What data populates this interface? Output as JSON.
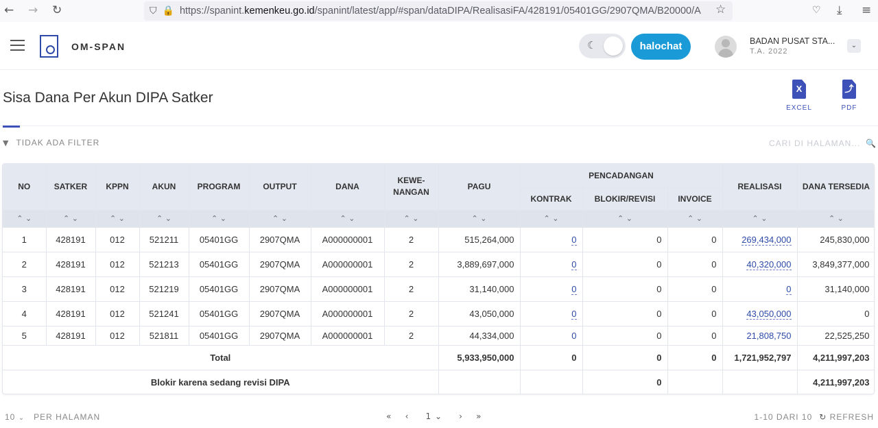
{
  "browser": {
    "url_prefix": "https://spanint.",
    "url_domain": "kemenkeu.go.id",
    "url_rest": "/spanint/latest/app/#span/dataDIPA/RealisasiFA/428191/05401GG/2907QMA/B20000/A"
  },
  "app": {
    "brand": "OM-SPAN",
    "chat_label": "halochat",
    "user_name": "BADAN PUSAT STA...",
    "user_year": "T.A. 2022"
  },
  "page": {
    "title": "Sisa Dana Per Akun DIPA Satker",
    "export_excel": "EXCEL",
    "export_pdf": "PDF",
    "filter": "TIDAK ADA FILTER",
    "search_placeholder": "CARI DI HALAMAN..."
  },
  "table": {
    "headers": {
      "no": "NO",
      "satker": "SATKER",
      "kppn": "KPPN",
      "akun": "AKUN",
      "program": "PROGRAM",
      "output": "OUTPUT",
      "dana": "DANA",
      "kewenangan": "KEWE-NANGAN",
      "pagu": "PAGU",
      "pencadangan": "PENCADANGAN",
      "kontrak": "KONTRAK",
      "blokir": "BLOKIR/REVISI",
      "invoice": "INVOICE",
      "realisasi": "REALISASI",
      "dana_tersedia": "DANA TERSEDIA"
    },
    "rows": [
      {
        "no": "1",
        "satker": "428191",
        "kppn": "012",
        "akun": "521211",
        "program": "05401GG",
        "output": "2907QMA",
        "dana": "A000000001",
        "kew": "2",
        "pagu": "515,264,000",
        "kontrak": "0",
        "blokir": "0",
        "invoice": "0",
        "realisasi": "269,434,000",
        "tersedia": "245,830,000"
      },
      {
        "no": "2",
        "satker": "428191",
        "kppn": "012",
        "akun": "521213",
        "program": "05401GG",
        "output": "2907QMA",
        "dana": "A000000001",
        "kew": "2",
        "pagu": "3,889,697,000",
        "kontrak": "0",
        "blokir": "0",
        "invoice": "0",
        "realisasi": "40,320,000",
        "tersedia": "3,849,377,000"
      },
      {
        "no": "3",
        "satker": "428191",
        "kppn": "012",
        "akun": "521219",
        "program": "05401GG",
        "output": "2907QMA",
        "dana": "A000000001",
        "kew": "2",
        "pagu": "31,140,000",
        "kontrak": "0",
        "blokir": "0",
        "invoice": "0",
        "realisasi": "0",
        "tersedia": "31,140,000"
      },
      {
        "no": "4",
        "satker": "428191",
        "kppn": "012",
        "akun": "521241",
        "program": "05401GG",
        "output": "2907QMA",
        "dana": "A000000001",
        "kew": "2",
        "pagu": "43,050,000",
        "kontrak": "0",
        "blokir": "0",
        "invoice": "0",
        "realisasi": "43,050,000",
        "tersedia": "0"
      },
      {
        "no": "5",
        "satker": "428191",
        "kppn": "012",
        "akun": "521811",
        "program": "05401GG",
        "output": "2907QMA",
        "dana": "A000000001",
        "kew": "2",
        "pagu": "44,334,000",
        "kontrak": "0",
        "blokir": "0",
        "invoice": "0",
        "realisasi": "21,808,750",
        "tersedia": "22,525,250"
      }
    ],
    "total": {
      "label": "Total",
      "pagu": "5,933,950,000",
      "kontrak": "0",
      "blokir": "0",
      "invoice": "0",
      "realisasi": "1,721,952,797",
      "tersedia": "4,211,997,203"
    },
    "blokir_row": {
      "label": "Blokir karena sedang revisi DIPA",
      "blokir": "0",
      "tersedia": "4,211,997,203"
    }
  },
  "pager": {
    "page_size": "10",
    "per_page_label": "PER HALAMAN",
    "current_page": "1",
    "range": "1-10 DARI 10",
    "refresh": "REFRESH"
  },
  "icons": {
    "back": "back-arrow-icon",
    "forward": "forward-arrow-icon",
    "reload": "reload-icon",
    "shield": "shield-icon",
    "lock": "lock-icon",
    "star": "star-icon",
    "filter": "funnel-icon",
    "search": "search-icon",
    "moon": "moon-icon"
  },
  "colors": {
    "accent": "#3d51b8",
    "chat": "#1a9ad6",
    "header_bg": "#e4e8f0"
  }
}
